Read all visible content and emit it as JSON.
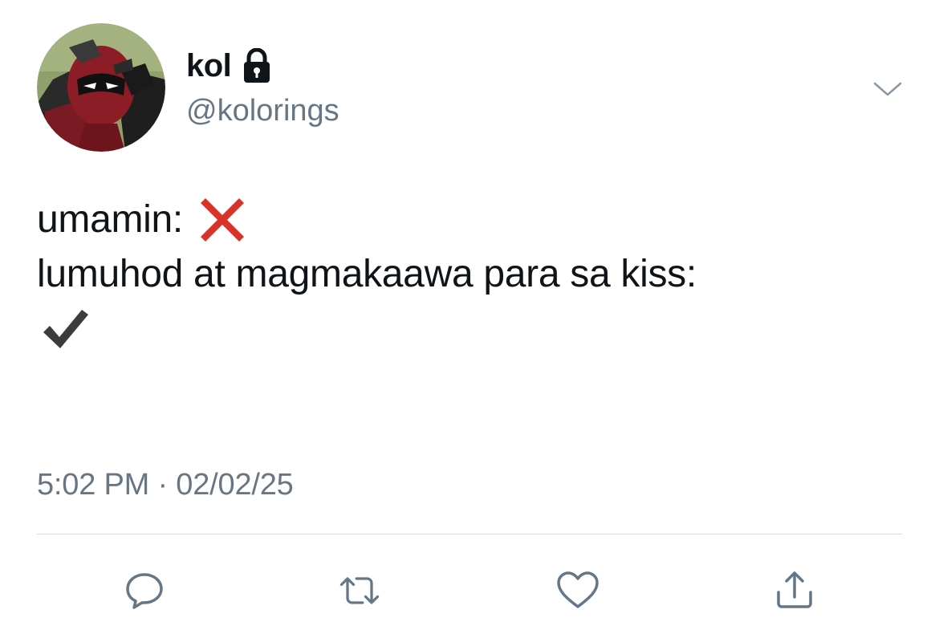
{
  "author": {
    "display_name": "kol",
    "handle": "@kolorings",
    "protected_icon": "lock-icon",
    "avatar_icon": "deadpool-avatar"
  },
  "tweet": {
    "line1_text": "umamin:",
    "line1_emoji": "cross-mark-icon",
    "line2_text": "lumuhod at magmakaawa para sa kiss:",
    "line3_emoji": "check-mark-icon"
  },
  "meta": {
    "timestamp": "5:02 PM · 02/02/25"
  },
  "menu": {
    "caret_icon": "chevron-down-icon"
  },
  "actions": [
    {
      "name": "reply",
      "icon": "reply-bubble-icon"
    },
    {
      "name": "retweet",
      "icon": "retweet-icon"
    },
    {
      "name": "like",
      "icon": "heart-icon"
    },
    {
      "name": "share",
      "icon": "share-icon"
    }
  ],
  "colors": {
    "text_primary": "#0f1419",
    "text_secondary": "#687684",
    "icon_gray": "#657786",
    "divider": "#d6dbdf",
    "cross_red": "#d9322b",
    "check_dark": "#3c3c3c"
  }
}
